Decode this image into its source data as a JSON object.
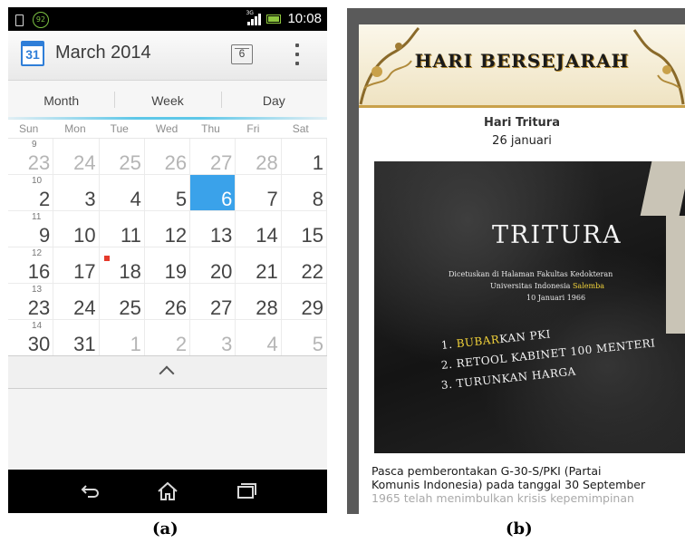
{
  "panel_a": {
    "caption": "(a)",
    "status_bar": {
      "battery_badge": "92",
      "network": "3G",
      "time": "10:08"
    },
    "action_bar": {
      "calendar_icon_day": "31",
      "title": "March 2014",
      "today_button_label": "6"
    },
    "view_tabs": [
      "Month",
      "Week",
      "Day"
    ],
    "weekdays": [
      "Sun",
      "Mon",
      "Tue",
      "Wed",
      "Thu",
      "Fri",
      "Sat"
    ],
    "weeks": [
      {
        "week_number": "9",
        "days": [
          {
            "d": "23",
            "other": true
          },
          {
            "d": "24",
            "other": true
          },
          {
            "d": "25",
            "other": true
          },
          {
            "d": "26",
            "other": true
          },
          {
            "d": "27",
            "other": true
          },
          {
            "d": "28",
            "other": true
          },
          {
            "d": "1"
          }
        ]
      },
      {
        "week_number": "10",
        "days": [
          {
            "d": "2"
          },
          {
            "d": "3"
          },
          {
            "d": "4"
          },
          {
            "d": "5"
          },
          {
            "d": "6",
            "today": true
          },
          {
            "d": "7"
          },
          {
            "d": "8"
          }
        ]
      },
      {
        "week_number": "11",
        "days": [
          {
            "d": "9"
          },
          {
            "d": "10"
          },
          {
            "d": "11"
          },
          {
            "d": "12"
          },
          {
            "d": "13"
          },
          {
            "d": "14"
          },
          {
            "d": "15"
          }
        ]
      },
      {
        "week_number": "12",
        "days": [
          {
            "d": "16"
          },
          {
            "d": "17"
          },
          {
            "d": "18",
            "event": true
          },
          {
            "d": "19"
          },
          {
            "d": "20"
          },
          {
            "d": "21"
          },
          {
            "d": "22"
          }
        ]
      },
      {
        "week_number": "13",
        "days": [
          {
            "d": "23"
          },
          {
            "d": "24"
          },
          {
            "d": "25"
          },
          {
            "d": "26"
          },
          {
            "d": "27"
          },
          {
            "d": "28"
          },
          {
            "d": "29"
          }
        ]
      },
      {
        "week_number": "14",
        "days": [
          {
            "d": "30"
          },
          {
            "d": "31"
          },
          {
            "d": "1",
            "other": true
          },
          {
            "d": "2",
            "other": true
          },
          {
            "d": "3",
            "other": true
          },
          {
            "d": "4",
            "other": true
          },
          {
            "d": "5",
            "other": true
          }
        ]
      }
    ],
    "colors": {
      "today_fill": "#3aa2ea",
      "event_marker": "#e53a2b",
      "tab_accent": "#5ec7e8"
    },
    "icons": [
      "calendar-icon",
      "today-icon",
      "overflow-menu-icon",
      "chevron-up-icon",
      "back-icon",
      "home-icon",
      "recent-apps-icon"
    ]
  },
  "panel_b": {
    "caption": "(b)",
    "banner_title": "HARI BERSEJARAH",
    "heading": "Hari Tritura",
    "date": "26 januari",
    "inscription": {
      "title": "TRITURA",
      "line1": "Dicetuskan di Halaman Fakultas Kedokteran",
      "line2_a": "Universitas Indonesia ",
      "line2_b": "Salemba",
      "line3": "10 Januari 1966",
      "item1_a": "1. ",
      "item1_b": "BUBAR",
      "item1_c": "KAN PKI",
      "item2": "2. RETOOL KABINET 100 MENTERI",
      "item3": "3. TURUNKAN HARGA"
    },
    "body_line1": "Pasca pemberontakan G-30-S/PKI (Partai",
    "body_line2": "Komunis Indonesia) pada tanggal 30 September",
    "body_line3": "1965 telah menimbulkan krisis kepemimpinan"
  }
}
